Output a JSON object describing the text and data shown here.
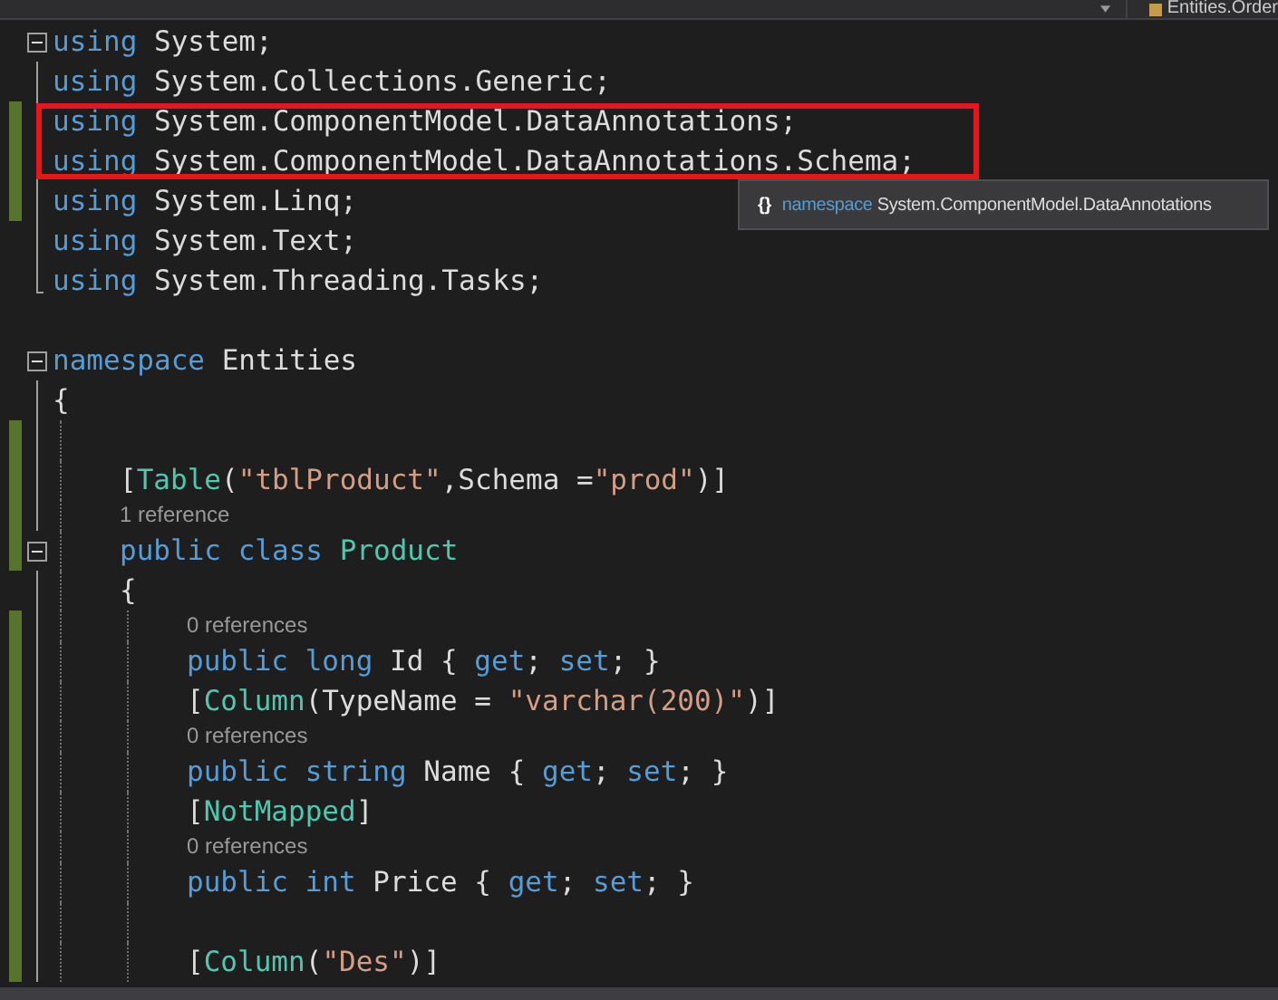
{
  "navigation_bar": {
    "type_dropdown": "Entities.Order"
  },
  "code": [
    {
      "expanded": true,
      "changed": false,
      "tokens": [
        {
          "text": "using",
          "kind": "keyword"
        },
        {
          "text": " System;",
          "kind": "plain"
        }
      ]
    },
    {
      "changed": false,
      "tokens": [
        {
          "text": "using",
          "kind": "keyword"
        },
        {
          "text": " System.Collections.Generic;",
          "kind": "plain"
        }
      ]
    },
    {
      "changed": true,
      "highlight": true,
      "tokens": [
        {
          "text": "using",
          "kind": "keyword"
        },
        {
          "text": " System.ComponentModel.DataAnnotations;",
          "kind": "plain"
        }
      ]
    },
    {
      "changed": true,
      "highlight": true,
      "tokens": [
        {
          "text": "using",
          "kind": "keyword"
        },
        {
          "text": " System.ComponentModel.DataAnnotations.Schema;",
          "kind": "plain"
        }
      ]
    },
    {
      "changed": true,
      "tokens": [
        {
          "text": "using",
          "kind": "keyword"
        },
        {
          "text": " System.Linq;",
          "kind": "plain"
        }
      ]
    },
    {
      "changed": false,
      "tokens": [
        {
          "text": "using",
          "kind": "keyword"
        },
        {
          "text": " System.Text;",
          "kind": "plain"
        }
      ]
    },
    {
      "changed": false,
      "tokens": [
        {
          "text": "using",
          "kind": "keyword"
        },
        {
          "text": " System.Threading.Tasks;",
          "kind": "plain"
        }
      ]
    },
    {
      "kind": "blank",
      "changed": false
    },
    {
      "expanded": true,
      "changed": false,
      "tokens": [
        {
          "text": "namespace",
          "kind": "keyword"
        },
        {
          "text": " Entities",
          "kind": "plain"
        }
      ]
    },
    {
      "changed": false,
      "tokens": [
        {
          "text": "{",
          "kind": "plain"
        }
      ],
      "children": [
        {
          "kind": "blank",
          "changed": true
        },
        {
          "changed": true,
          "tokens": [
            {
              "text": "[",
              "kind": "plain"
            },
            {
              "text": "Table",
              "kind": "type"
            },
            {
              "text": "(",
              "kind": "plain"
            },
            {
              "text": "\"tblProduct\"",
              "kind": "string"
            },
            {
              "text": ",Schema =",
              "kind": "plain"
            },
            {
              "text": "\"prod\"",
              "kind": "string"
            },
            {
              "text": ")]",
              "kind": "plain"
            }
          ]
        },
        {
          "kind": "lens",
          "changed": true,
          "text": "1 reference"
        },
        {
          "expanded": true,
          "changed": true,
          "tokens": [
            {
              "text": "public",
              "kind": "keyword"
            },
            {
              "text": " class",
              "kind": "keyword"
            },
            {
              "text": " Product",
              "kind": "type"
            }
          ]
        },
        {
          "changed": false,
          "tokens": [
            {
              "text": "{",
              "kind": "plain"
            }
          ],
          "children": [
            {
              "kind": "lens",
              "changed": true,
              "text": "0 references"
            },
            {
              "changed": true,
              "tokens": [
                {
                  "text": "public",
                  "kind": "keyword"
                },
                {
                  "text": " long",
                  "kind": "keyword"
                },
                {
                  "text": " Id { ",
                  "kind": "plain"
                },
                {
                  "text": "get",
                  "kind": "keyword"
                },
                {
                  "text": "; ",
                  "kind": "plain"
                },
                {
                  "text": "set",
                  "kind": "keyword"
                },
                {
                  "text": "; }",
                  "kind": "plain"
                }
              ]
            },
            {
              "changed": true,
              "tokens": [
                {
                  "text": "[",
                  "kind": "plain"
                },
                {
                  "text": "Column",
                  "kind": "type"
                },
                {
                  "text": "(TypeName = ",
                  "kind": "plain"
                },
                {
                  "text": "\"varchar(200)\"",
                  "kind": "string"
                },
                {
                  "text": ")]",
                  "kind": "plain"
                }
              ]
            },
            {
              "kind": "lens",
              "changed": true,
              "text": "0 references"
            },
            {
              "changed": true,
              "tokens": [
                {
                  "text": "public",
                  "kind": "keyword"
                },
                {
                  "text": " string",
                  "kind": "keyword"
                },
                {
                  "text": " Name { ",
                  "kind": "plain"
                },
                {
                  "text": "get",
                  "kind": "keyword"
                },
                {
                  "text": "; ",
                  "kind": "plain"
                },
                {
                  "text": "set",
                  "kind": "keyword"
                },
                {
                  "text": "; }",
                  "kind": "plain"
                }
              ]
            },
            {
              "changed": true,
              "tokens": [
                {
                  "text": "[",
                  "kind": "plain"
                },
                {
                  "text": "NotMapped",
                  "kind": "type"
                },
                {
                  "text": "]",
                  "kind": "plain"
                }
              ]
            },
            {
              "kind": "lens",
              "changed": true,
              "text": "0 references"
            },
            {
              "changed": true,
              "tokens": [
                {
                  "text": "public",
                  "kind": "keyword"
                },
                {
                  "text": " int",
                  "kind": "keyword"
                },
                {
                  "text": " Price { ",
                  "kind": "plain"
                },
                {
                  "text": "get",
                  "kind": "keyword"
                },
                {
                  "text": "; ",
                  "kind": "plain"
                },
                {
                  "text": "set",
                  "kind": "keyword"
                },
                {
                  "text": "; }",
                  "kind": "plain"
                }
              ]
            },
            {
              "kind": "blank",
              "changed": true
            },
            {
              "changed": true,
              "tokens": [
                {
                  "text": "[",
                  "kind": "plain"
                },
                {
                  "text": "Column",
                  "kind": "type"
                },
                {
                  "text": "(",
                  "kind": "plain"
                },
                {
                  "text": "\"Des\"",
                  "kind": "string"
                },
                {
                  "text": ")]",
                  "kind": "plain"
                }
              ]
            }
          ]
        }
      ]
    }
  ],
  "tooltip": {
    "icon": "{}",
    "keyword": "namespace",
    "text": "System.ComponentModel.DataAnnotations"
  }
}
